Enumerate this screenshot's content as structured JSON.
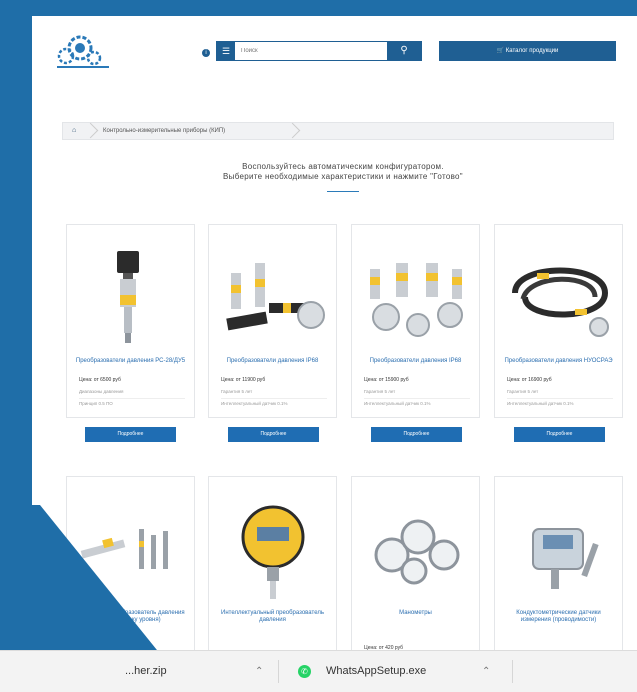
{
  "header": {
    "search_placeholder": "Поиск",
    "search_icon": "search-icon",
    "menu_icon": "menu-icon",
    "info_icon": "info-icon",
    "cart_label": "Каталог продукции",
    "cart_icon": "cart-icon",
    "brand_color": "#1f5f93"
  },
  "breadcrumb": {
    "home_icon": "home-icon",
    "items": [
      "Контрольно-измерительные приборы (КИП)"
    ]
  },
  "intro": {
    "line1": "Воспользуйтесь автоматическим конфигуратором.",
    "line2": "Выберите необходимые характеристики и нажмите \"Готово\""
  },
  "products": [
    {
      "title": "Преобразователи давления РС-28/ДУ5",
      "price": "Цена: от 6500 руб",
      "meta1": "Диапазоны давления",
      "meta2": "Принцип 0.5 ПО"
    },
    {
      "title": "Преобразователи давления IP68",
      "price": "Цена: от 11900 руб",
      "meta1": "Гарантия 5 лет",
      "meta2": "Интеллектуальный датчик 0.1%"
    },
    {
      "title": "Преобразователи давления IP68",
      "price": "Цена: от 15900 руб",
      "meta1": "Гарантия 5 лет",
      "meta2": "Интеллектуальный датчик 0.1%"
    },
    {
      "title": "Преобразователи давления НУОСРАЭ",
      "price": "Цена: от 16900 руб",
      "meta1": "Гарантия 5 лет",
      "meta2": "Интеллектуальный датчик 0.1%"
    },
    {
      "title": "Погружной преобразователь давления SC-25 (Блоку уровня)",
      "price": "",
      "meta1": "",
      "meta2": ""
    },
    {
      "title": "Интеллектуальный преобразователь давления",
      "price": "",
      "meta1": "",
      "meta2": ""
    },
    {
      "title": "Манометры",
      "price": "Цена: от 420 руб",
      "meta1": "",
      "meta2": ""
    },
    {
      "title": "Кондуктометрические датчики измерения (проводимости)",
      "price": "",
      "meta1": "",
      "meta2": ""
    }
  ],
  "details_label": "Подробнее",
  "downloads": [
    {
      "name": "...her.zip"
    },
    {
      "name": "WhatsAppSetup.exe"
    }
  ],
  "overlay_color": "#1f6ea8"
}
